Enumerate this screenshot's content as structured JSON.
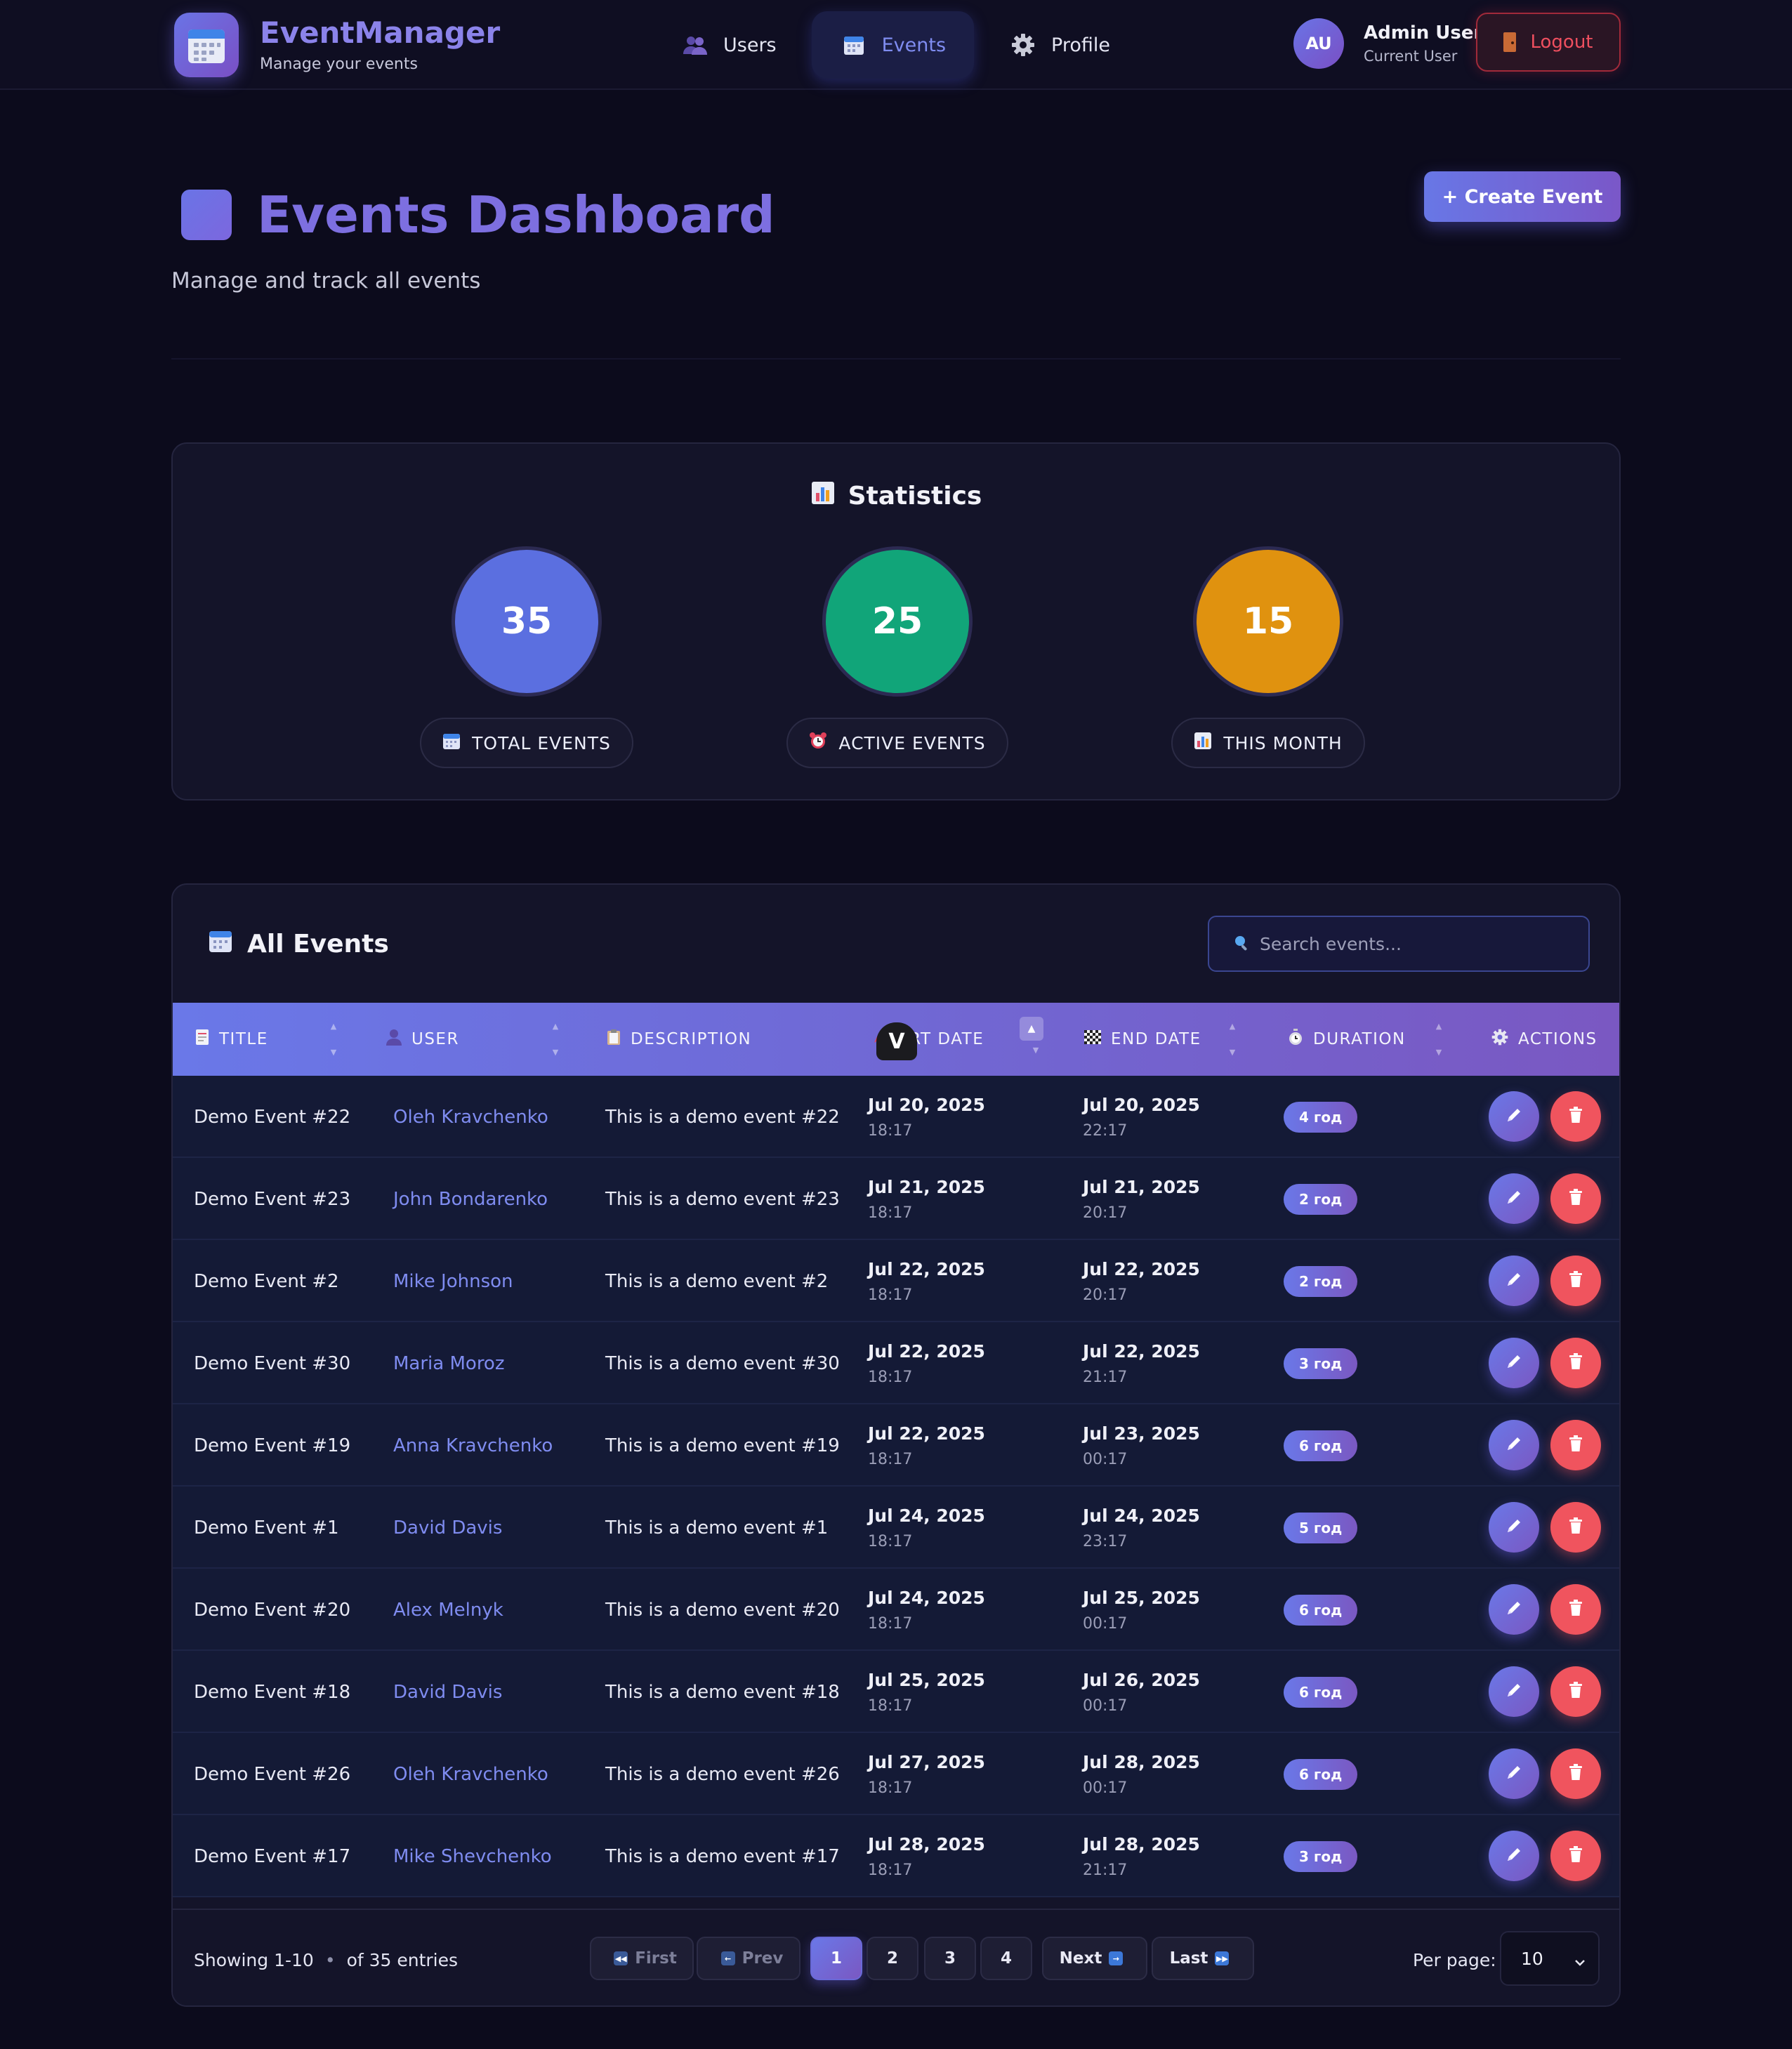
{
  "header": {
    "app_title": "EventManager",
    "app_subtitle": "Manage your events",
    "nav": [
      {
        "label": "Users",
        "icon": "users-icon"
      },
      {
        "label": "Events",
        "icon": "calendar-icon",
        "active": true
      },
      {
        "label": "Profile",
        "icon": "gear-icon"
      }
    ],
    "user": {
      "initials": "AU",
      "name": "Admin User",
      "role": "Current User"
    },
    "logout_label": "Logout"
  },
  "page": {
    "title": "Events Dashboard",
    "subtitle": "Manage and track all events",
    "create_label": "+ Create Event"
  },
  "stats": {
    "title": "Statistics",
    "items": [
      {
        "value": "35",
        "label": "TOTAL EVENTS",
        "color": "#5b6fe0",
        "icon": "calendar-icon"
      },
      {
        "value": "25",
        "label": "ACTIVE EVENTS",
        "color": "#11a579",
        "icon": "alarm-clock-icon"
      },
      {
        "value": "15",
        "label": "THIS MONTH",
        "color": "#e0920f",
        "icon": "bar-chart-icon"
      }
    ]
  },
  "events": {
    "title": "All Events",
    "search_placeholder": "Search events...",
    "columns": [
      "TITLE",
      "USER",
      "DESCRIPTION",
      "ART DATE",
      "END DATE",
      "DURATION",
      "ACTIONS"
    ],
    "cursor_glyph": "V",
    "rows": [
      {
        "title": "Demo Event #22",
        "user": "Oleh Kravchenko",
        "description": "This is a demo event #22",
        "start_date": "Jul 20, 2025",
        "start_time": "18:17",
        "end_date": "Jul 20, 2025",
        "end_time": "22:17",
        "duration": "4 год"
      },
      {
        "title": "Demo Event #23",
        "user": "John Bondarenko",
        "description": "This is a demo event #23",
        "start_date": "Jul 21, 2025",
        "start_time": "18:17",
        "end_date": "Jul 21, 2025",
        "end_time": "20:17",
        "duration": "2 год"
      },
      {
        "title": "Demo Event #2",
        "user": "Mike Johnson",
        "description": "This is a demo event #2",
        "start_date": "Jul 22, 2025",
        "start_time": "18:17",
        "end_date": "Jul 22, 2025",
        "end_time": "20:17",
        "duration": "2 год"
      },
      {
        "title": "Demo Event #30",
        "user": "Maria Moroz",
        "description": "This is a demo event #30",
        "start_date": "Jul 22, 2025",
        "start_time": "18:17",
        "end_date": "Jul 22, 2025",
        "end_time": "21:17",
        "duration": "3 год"
      },
      {
        "title": "Demo Event #19",
        "user": "Anna Kravchenko",
        "description": "This is a demo event #19",
        "start_date": "Jul 22, 2025",
        "start_time": "18:17",
        "end_date": "Jul 23, 2025",
        "end_time": "00:17",
        "duration": "6 год"
      },
      {
        "title": "Demo Event #1",
        "user": "David Davis",
        "description": "This is a demo event #1",
        "start_date": "Jul 24, 2025",
        "start_time": "18:17",
        "end_date": "Jul 24, 2025",
        "end_time": "23:17",
        "duration": "5 год"
      },
      {
        "title": "Demo Event #20",
        "user": "Alex Melnyk",
        "description": "This is a demo event #20",
        "start_date": "Jul 24, 2025",
        "start_time": "18:17",
        "end_date": "Jul 25, 2025",
        "end_time": "00:17",
        "duration": "6 год"
      },
      {
        "title": "Demo Event #18",
        "user": "David Davis",
        "description": "This is a demo event #18",
        "start_date": "Jul 25, 2025",
        "start_time": "18:17",
        "end_date": "Jul 26, 2025",
        "end_time": "00:17",
        "duration": "6 год"
      },
      {
        "title": "Demo Event #26",
        "user": "Oleh Kravchenko",
        "description": "This is a demo event #26",
        "start_date": "Jul 27, 2025",
        "start_time": "18:17",
        "end_date": "Jul 28, 2025",
        "end_time": "00:17",
        "duration": "6 год"
      },
      {
        "title": "Demo Event #17",
        "user": "Mike Shevchenko",
        "description": "This is a demo event #17",
        "start_date": "Jul 28, 2025",
        "start_time": "18:17",
        "end_date": "Jul 28, 2025",
        "end_time": "21:17",
        "duration": "3 год"
      }
    ]
  },
  "pagination": {
    "showing": "Showing 1-10",
    "separator": "•",
    "total": "of 35 entries",
    "first_label": "First",
    "prev_label": "Prev",
    "pages": [
      "1",
      "2",
      "3",
      "4"
    ],
    "current_page": "1",
    "next_label": "Next",
    "last_label": "Last",
    "per_page_label": "Per page:",
    "per_page_value": "10"
  }
}
